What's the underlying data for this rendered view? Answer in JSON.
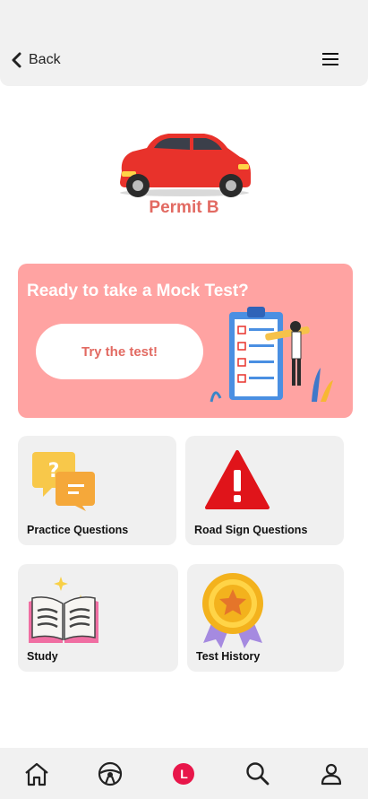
{
  "header": {
    "back_label": "Back",
    "back_icon": "chevron-left-icon",
    "menu_icon": "hamburger-menu-icon"
  },
  "hero": {
    "title": "Permit B",
    "image": "red-car-illustration"
  },
  "mock_test": {
    "title": "Ready to take a Mock Test?",
    "button_label": "Try the test!",
    "image": "clipboard-checklist-illustration"
  },
  "tiles": [
    {
      "label": "Practice Questions",
      "icon": "question-chat-icon"
    },
    {
      "label": "Road Sign Questions",
      "icon": "warning-sign-icon"
    },
    {
      "label": "Study",
      "icon": "open-book-icon"
    },
    {
      "label": "Test History",
      "icon": "award-medal-icon"
    }
  ],
  "bottom_nav": {
    "items": [
      {
        "icon": "home-icon"
      },
      {
        "icon": "steering-wheel-icon"
      },
      {
        "icon": "learner-badge-icon",
        "badge_text": "L"
      },
      {
        "icon": "search-icon"
      },
      {
        "icon": "profile-icon"
      }
    ]
  },
  "colors": {
    "accent": "#e26a62",
    "card_bg": "#ffa3a2",
    "tile_bg": "#f0f0f0",
    "bar_bg": "#f1f1f1",
    "badge": "#e8164a"
  }
}
